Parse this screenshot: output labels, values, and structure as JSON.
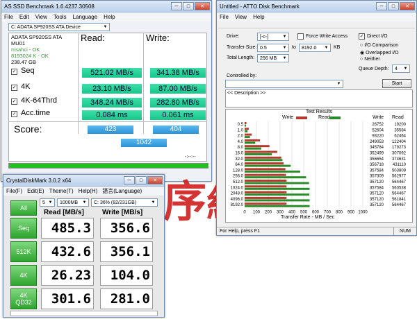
{
  "asssd": {
    "title": "AS SSD Benchmark 1.6.4237.30508",
    "menu": [
      "File",
      "Edit",
      "View",
      "Tools",
      "Language",
      "Help"
    ],
    "drive_select": "C: ADATA SP920SS ATA Device",
    "device_info": [
      "ADATA SP920SS ATA",
      "MU01",
      "msahci - OK",
      "8193024 K - OK",
      "238.47 GB"
    ],
    "read_header": "Read:",
    "write_header": "Write:",
    "rows": [
      {
        "label": "Seq",
        "read": "521.02 MB/s",
        "write": "341.38 MB/s"
      },
      {
        "label": "4K",
        "read": "23.10 MB/s",
        "write": "87.00 MB/s"
      },
      {
        "label": "4K-64Thrd",
        "read": "348.24 MB/s",
        "write": "282.80 MB/s"
      },
      {
        "label": "Acc.time",
        "read": "0.084 ms",
        "write": "0.061 ms"
      }
    ],
    "score_label": "Score:",
    "score_read": "423",
    "score_write": "404",
    "score_total": "1042",
    "progress_time": "-:--:--",
    "check_mark": "✓"
  },
  "cdm": {
    "title": "CrystalDiskMark 3.0.2 x64",
    "menu": [
      "File(F)",
      "Edit(E)",
      "Theme(T)",
      "Help(H)",
      "語言(Language)"
    ],
    "all_label": "All",
    "runs": "5",
    "size": "1000MB",
    "drive": "C: 36% (82/231GB)",
    "read_header": "Read [MB/s]",
    "write_header": "Write [MB/s]",
    "rows": [
      {
        "label": "Seq",
        "sub": "",
        "read": "485.3",
        "write": "356.6"
      },
      {
        "label": "512K",
        "sub": "",
        "read": "432.6",
        "write": "356.1"
      },
      {
        "label": "4K",
        "sub": "",
        "read": "26.23",
        "write": "104.0"
      },
      {
        "label": "4K",
        "sub": "QD32",
        "read": "301.6",
        "write": "281.0"
      }
    ]
  },
  "atto": {
    "title": "Untitled - ATTO Disk Benchmark",
    "menu": [
      "File",
      "View",
      "Help"
    ],
    "drive_label": "Drive:",
    "drive_value": "[-c-]",
    "force_write": "Force Write Access",
    "direct_io": "Direct I/O",
    "transfer_label": "Transfer Size:",
    "transfer_from": "0.5",
    "to": "to",
    "transfer_to": "8192.0",
    "kb": "KB",
    "total_label": "Total Length:",
    "total_value": "256 MB",
    "io_comparison": "I/O Comparison",
    "overlapped_io": "Overlapped I/O",
    "neither": "Neither",
    "queue_label": "Queue Depth:",
    "queue_value": "4",
    "controlled_label": "Controlled by:",
    "start": "Start",
    "description": "<< Description >>",
    "test_results": "Test Results",
    "legend_write": "Write",
    "legend_read": "Read",
    "col_write": "Write",
    "col_read": "Read",
    "xlabel": "Transfer Rate - MB / Sec",
    "xticks": [
      "0",
      "100",
      "200",
      "300",
      "400",
      "500",
      "600",
      "700",
      "800",
      "900",
      "1000"
    ],
    "status": "For Help, press F1",
    "num": "NUM"
  },
  "chart_data": {
    "type": "bar",
    "title": "Test Results",
    "xlabel": "Transfer Rate - MB / Sec",
    "xlim": [
      0,
      1000
    ],
    "categories": [
      "0.5",
      "1.0",
      "2.0",
      "4.0",
      "8.0",
      "16.0",
      "32.0",
      "64.0",
      "128.0",
      "256.0",
      "512.0",
      "1024.0",
      "2048.0",
      "4096.0",
      "8192.0"
    ],
    "series": [
      {
        "name": "Write",
        "values": [
          26752,
          52604,
          93220,
          249053,
          345784,
          352499,
          356654,
          356718,
          357584,
          357309,
          357120,
          357584,
          357120,
          357120,
          357120
        ],
        "bar_mb": [
          15,
          35,
          60,
          130,
          210,
          275,
          310,
          330,
          345,
          350,
          355,
          355,
          355,
          355,
          355
        ]
      },
      {
        "name": "Read",
        "values": [
          19200,
          35584,
          62464,
          122404,
          179273,
          307092,
          374631,
          431110,
          503809,
          562977,
          564467,
          560538,
          564467,
          561841,
          564467
        ],
        "bar_mb": [
          12,
          25,
          45,
          90,
          140,
          230,
          320,
          390,
          470,
          520,
          545,
          550,
          548,
          550,
          550
        ]
      }
    ],
    "legend": "top"
  }
}
